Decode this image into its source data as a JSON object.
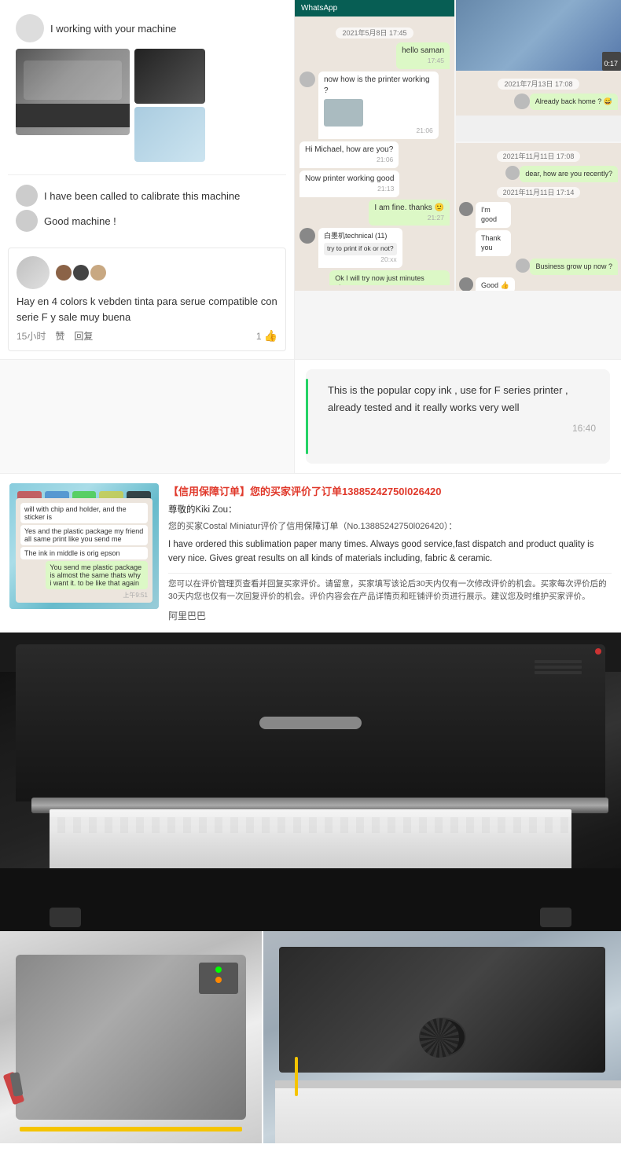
{
  "reviews": {
    "working_label": "I working with your machine",
    "calibrate_text": "I have been called to calibrate this machine",
    "good_machine": "Good machine !",
    "spanish_review": {
      "text": "Hay en 4 colors k vebden tinta para serue compatible con serie F y sale muy buena",
      "time": "15小时",
      "like": "赞",
      "reply": "回复",
      "count": "1"
    }
  },
  "chat": {
    "greeting": "hello saman",
    "msg1": "now how is the printer working ?",
    "time1": "21:06",
    "msg2": "Hi Michael, how are you?",
    "time2": "21:06",
    "msg3": "Now printer working good",
    "time3": "21:13",
    "msg4": "I am fine. thanks 🙂",
    "time4": "21:27",
    "date1": "2021年5月8日 17:45",
    "date2": "Already back home ? 😅",
    "date3": "2021年7月13日 17:08",
    "date4": "2021年11月11日 17:08",
    "msg5": "dear, how are you recently?",
    "date5": "2021年11月11日 17:14",
    "msg6": "I'm good",
    "msg7": "Thank you",
    "msg8": "Business grow up now ?",
    "msg9": "Good 👍"
  },
  "popular_ink": {
    "chat_text": "This is the popular copy ink , use for F series printer ,\nalready tested and it really works very well",
    "time": "16:40"
  },
  "order_review": {
    "title": "【信用保障订单】您的买家评价了订单13885242750l026420",
    "greeting": "尊敬的Kiki Zou：",
    "line1": "您的买家Costal Miniatur评价了信用保障订单（No.13885242750l026420）：",
    "review_text": "I have ordered this sublimation paper many times. Always good service,fast dispatch and product quality is very nice. Gives great results on all kinds of materials including, fabric & ceramic.",
    "line2": "您可以在评价管理页查看并回复买家评价。请留意，买家填写该论后30天内仅有一次修改评价的机会。买家每次评价后的30天内您也仅有一次回复评价的机会。评价内容会在产品详情页和旺铺评价页进行展示。建议您及时维护买家评价。",
    "footer": "阿里巴巴",
    "chat_overlay": {
      "msg1": "will with chip and holder, and the sticker is",
      "msg2": "Yes and the plastic package my friend all same print like you send me",
      "msg3": "The ink in middle is orig epson",
      "msg4": "You send me plastic package is almost the same thats why i want it. to be like that again",
      "time": "上午9:51"
    }
  },
  "printer": {
    "main_image_alt": "Large format printer with paper roll",
    "bottom_left_alt": "Printer side view",
    "bottom_right_alt": "Printer roll paper close-up"
  }
}
